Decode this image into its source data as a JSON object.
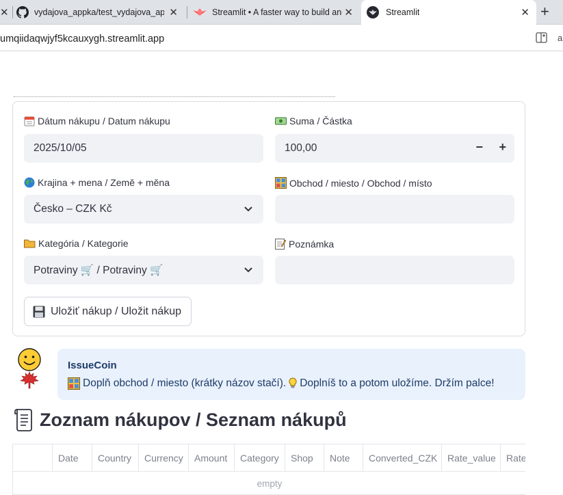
{
  "browser": {
    "tabs": [
      {
        "title": "vydajova_appka/test_vydajova_appka",
        "icon": "github-icon",
        "active": false
      },
      {
        "title": "Streamlit • A faster way to build and share data apps",
        "icon": "streamlit-icon",
        "active": false
      },
      {
        "title": "Streamlit",
        "icon": "streamlit-icon",
        "active": true
      }
    ],
    "url": "umqiidaqwjyf5kcauxygh.streamlit.app"
  },
  "form": {
    "date_label": "Dátum nákupu / Datum nákupu",
    "date_value": "2025/10/05",
    "amount_label": "Suma / Částka",
    "amount_value": "100,00",
    "country_label": "Krajina + mena / Země + měna",
    "country_value": "Česko – CZK Kč",
    "shop_label": "Obchod / miesto / Obchod / místo",
    "shop_value": "",
    "category_label": "Kategória / Kategorie",
    "category_value": "Potraviny 🛒 / Potraviny 🛒",
    "note_label": "Poznámka",
    "note_value": "",
    "save_label": "Uložiť nákup / Uložit nákup"
  },
  "chat": {
    "name": "IssueCoin",
    "message_part1": "Doplň obchod / miesto (krátky názov stačí).",
    "message_part2": "Doplníš to a potom uložíme. Držím palce!"
  },
  "list": {
    "heading": "Zoznam nákupov / Seznam nákupů",
    "columns": [
      "Date",
      "Country",
      "Currency",
      "Amount",
      "Category",
      "Shop",
      "Note",
      "Converted_CZK",
      "Rate_value",
      "Rate"
    ],
    "empty_text": "empty"
  },
  "colors": {
    "input_bg": "#f0f2f6",
    "chat_bg": "#e9f1fd",
    "text": "#31333f"
  }
}
